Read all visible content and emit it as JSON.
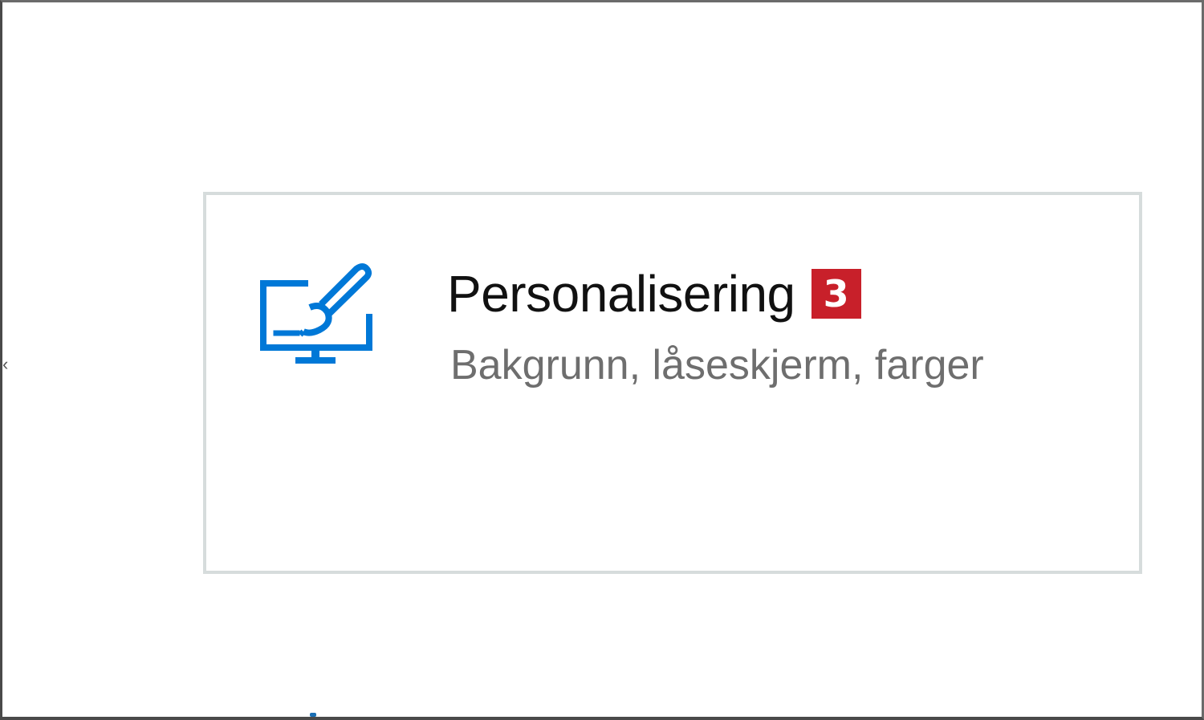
{
  "tile": {
    "title": "Personalisering",
    "badge": "3",
    "subtitle": "Bakgrunn, låseskjerm, farger",
    "icon": "personalization-monitor-brush-icon"
  },
  "colors": {
    "accent": "#0078d7",
    "badge": "#c8202a",
    "tile_border": "#d6dcdc"
  }
}
